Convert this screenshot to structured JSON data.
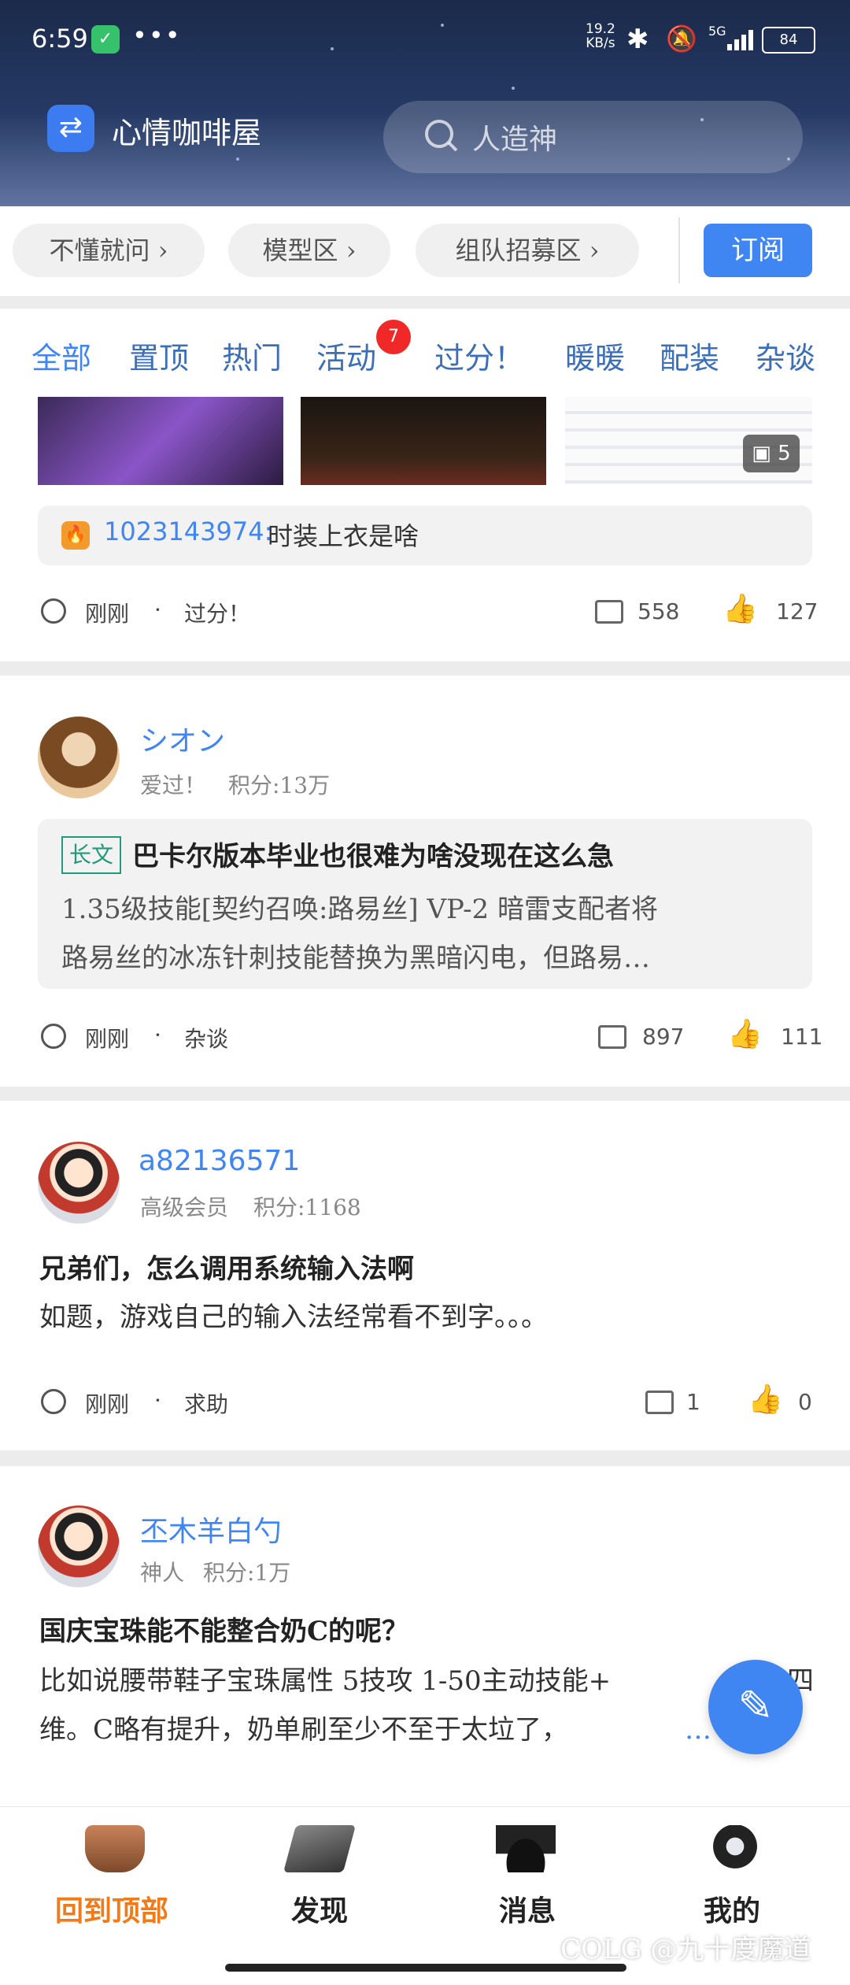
{
  "status_bar": {
    "time": "6:59",
    "net_speed_value": "19.2",
    "net_speed_unit": "KB/s",
    "network": "5G",
    "battery": "84"
  },
  "header": {
    "app_title": "心情咖啡屋",
    "search_placeholder": "人造神"
  },
  "areas": {
    "chips": [
      "不懂就问",
      "模型区",
      "组队招募区"
    ],
    "subscribe_label": "订阅"
  },
  "tabs": {
    "items": [
      "全部",
      "置顶",
      "热门",
      "活动",
      "过分！",
      "暖暖",
      "配装",
      "杂谈"
    ],
    "active": "全部",
    "activity_badge": "7"
  },
  "posts": [
    {
      "image_count": "5",
      "reply_user": "1023143974:",
      "reply_text": "时装上衣是啥",
      "time": "刚刚",
      "category": "过分！",
      "comments": "558",
      "likes": "127"
    },
    {
      "username": "シオン",
      "level": "爱过！",
      "score": "积分:13万",
      "tag": "长文",
      "title": "巴卡尔版本毕业也很难为啥没现在这么急",
      "body_line1": "1.35级技能[契约召唤:路易丝] VP-2 暗雷支配者将",
      "body_line2": "路易丝的冰冻针刺技能替换为黑暗闪电，但路易…",
      "time": "刚刚",
      "category": "杂谈",
      "comments": "897",
      "likes": "111"
    },
    {
      "username": "a82136571",
      "level": "高级会员",
      "score": "积分:1168",
      "title": "兄弟们，怎么调用系统输入法啊",
      "body_line1": "如题，游戏自己的输入法经常看不到字。。。",
      "time": "刚刚",
      "category": "求助",
      "comments": "1",
      "likes": "0"
    },
    {
      "username": "丕木羊白勺",
      "level": "神人",
      "score": "积分:1万",
      "title": "国庆宝珠能不能整合奶C的呢？",
      "body_line1": "比如说腰带鞋子宝珠属性 5技攻 1-50主动技能+",
      "body_line1_tail": "四",
      "body_line2": "维。C略有提升，奶单刷至少不至于太垃了，",
      "more": "…"
    }
  ],
  "bottom_nav": {
    "items": [
      "回到顶部",
      "发现",
      "消息",
      "我的"
    ],
    "active": "回到顶部"
  },
  "watermark": "COLG @九十度魔道",
  "colors": {
    "accent": "#3f86f3",
    "nav_active": "#f07b1a",
    "badge": "#f02828"
  }
}
